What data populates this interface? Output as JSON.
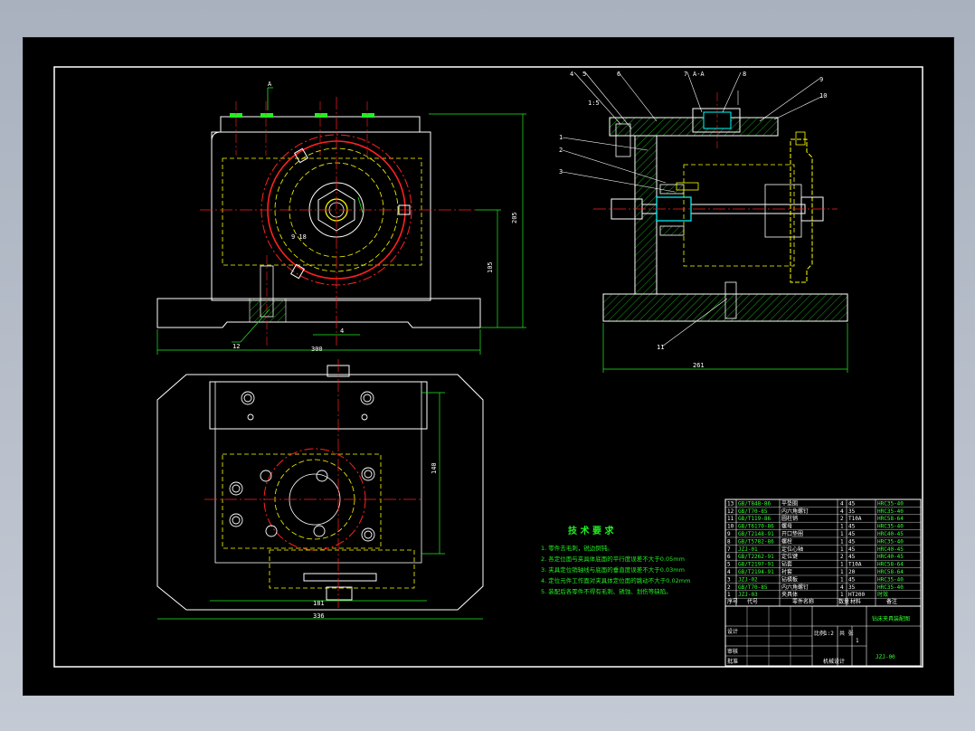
{
  "tech_requirements": {
    "title": "技 术 要 求",
    "items": [
      "1. 零件去毛刺，锐边倒钝。",
      "2. 各定位面与夹具体底面的平行度误差不大于0.05mm",
      "3. 夹具定位销轴线与底面的垂直度误差不大于0.03mm",
      "4. 定位元件工作面对夹具体定位面的跳动不大于0.02mm",
      "5. 装配后各零件不得有毛刺、锈蚀、划伤等缺陷。"
    ]
  },
  "dimensions": {
    "front_width": "300",
    "front_height_total": "205",
    "front_height_center": "105",
    "front_small": "4",
    "plan_width": "336",
    "plan_inner_width": "181",
    "plan_height": "140",
    "side_width": "261"
  },
  "balloons": [
    "4",
    "5",
    "6",
    "7",
    "8",
    "9",
    "10",
    "1",
    "2",
    "3",
    "11",
    "12"
  ],
  "view_labels": {
    "section_a": "A-A",
    "note_left": "1:5",
    "note_angle": "9 18"
  },
  "bom": {
    "rows": [
      {
        "no": "13",
        "code": "GB/T848-86",
        "name": "平垫圈",
        "qty": "4",
        "material": "45",
        "note": "HRC35-40"
      },
      {
        "no": "12",
        "code": "GB/T70-85",
        "name": "内六角螺钉",
        "qty": "4",
        "material": "35",
        "note": "HRC35-40"
      },
      {
        "no": "11",
        "code": "GB/T119-86",
        "name": "圆柱销",
        "qty": "2",
        "material": "T10A",
        "note": "HRC58-64"
      },
      {
        "no": "10",
        "code": "GB/T6170-86",
        "name": "螺母",
        "qty": "1",
        "material": "45",
        "note": "HRC35-40"
      },
      {
        "no": "9",
        "code": "GB/T2148-91",
        "name": "开口垫圈",
        "qty": "1",
        "material": "45",
        "note": "HRC40-45"
      },
      {
        "no": "8",
        "code": "GB/T5782-86",
        "name": "螺栓",
        "qty": "1",
        "material": "45",
        "note": "HRC35-40"
      },
      {
        "no": "7",
        "code": "JZJ-01",
        "name": "定位心轴",
        "qty": "1",
        "material": "45",
        "note": "HRC40-45"
      },
      {
        "no": "6",
        "code": "GB/T2262-91",
        "name": "定位键",
        "qty": "2",
        "material": "45",
        "note": "HRC40-45"
      },
      {
        "no": "5",
        "code": "GB/T2197-91",
        "name": "钻套",
        "qty": "1",
        "material": "T10A",
        "note": "HRC58-64"
      },
      {
        "no": "4",
        "code": "GB/T2194-91",
        "name": "衬套",
        "qty": "1",
        "material": "20",
        "note": "HRC58-64"
      },
      {
        "no": "3",
        "code": "JZJ-02",
        "name": "钻模板",
        "qty": "1",
        "material": "45",
        "note": "HRC35-40"
      },
      {
        "no": "2",
        "code": "GB/T70-85",
        "name": "内六角螺钉",
        "qty": "4",
        "material": "35",
        "note": "HRC35-40"
      },
      {
        "no": "1",
        "code": "JZJ-03",
        "name": "夹具体",
        "qty": "1",
        "material": "HT200",
        "note": "时效"
      }
    ],
    "header": {
      "no": "序号",
      "code": "代号",
      "name": "零件名称",
      "qty": "数量",
      "material": "材料",
      "note": "备注"
    }
  },
  "title_block": {
    "drawing_title": "钻床夹具装配图",
    "drawing_code": "JZJ-00",
    "scale_label": "比例",
    "scale": "1:2",
    "sheet_label": "共 张",
    "sheet": "1",
    "rows": [
      "设计",
      "审核",
      "批准"
    ],
    "company": "机械设计"
  },
  "colors": {
    "sheet_bg": "#000000",
    "outline": "#ffffff",
    "hidden": "#ffff00",
    "center": "#ff2020",
    "dimension": "#22ee22",
    "hatch": "#22cc22",
    "part": "#00ffff"
  }
}
